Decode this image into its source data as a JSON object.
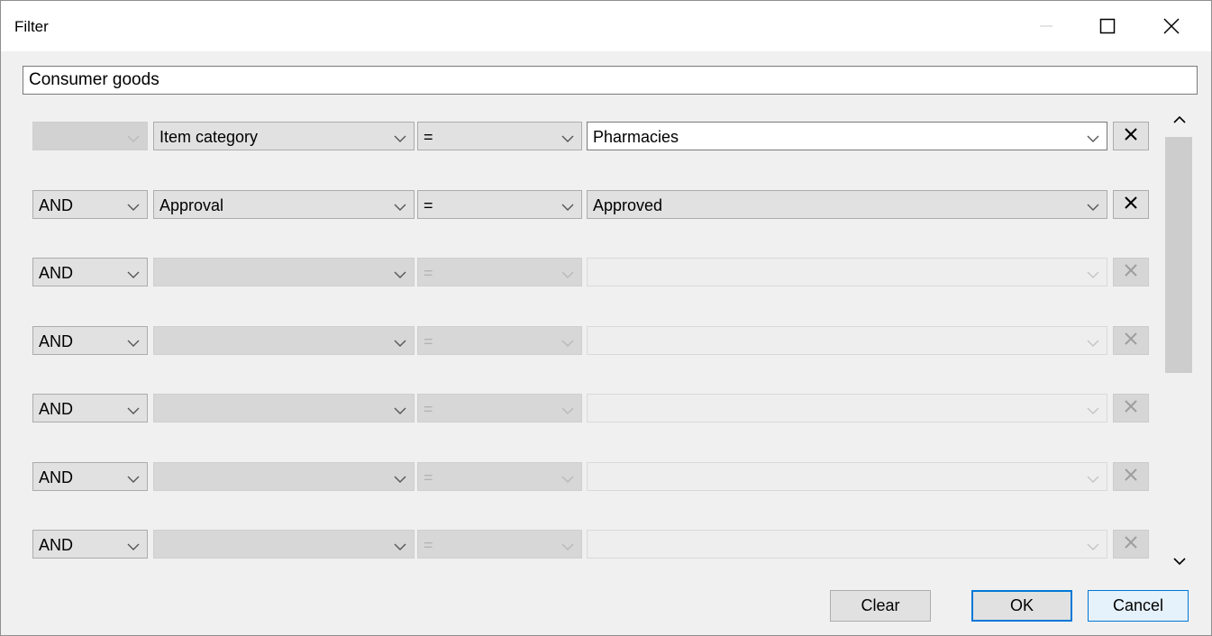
{
  "window": {
    "title": "Filter",
    "controls": [
      "minimize-icon",
      "maximize-icon",
      "close-icon"
    ]
  },
  "filter_name": {
    "value": "Consumer goods"
  },
  "rows": [
    {
      "logic": "",
      "field": "Item category",
      "operator": "=",
      "value": "Pharmacies",
      "enabled": true
    },
    {
      "logic": "AND",
      "field": "Approval",
      "operator": "=",
      "value": "Approved",
      "enabled": true
    },
    {
      "logic": "AND",
      "field": "",
      "operator": "=",
      "value": "",
      "enabled": false
    },
    {
      "logic": "AND",
      "field": "",
      "operator": "=",
      "value": "",
      "enabled": false
    },
    {
      "logic": "AND",
      "field": "",
      "operator": "=",
      "value": "",
      "enabled": false
    },
    {
      "logic": "AND",
      "field": "",
      "operator": "=",
      "value": "",
      "enabled": false
    },
    {
      "logic": "AND",
      "field": "",
      "operator": "=",
      "value": "",
      "enabled": false
    }
  ],
  "buttons": {
    "clear": "Clear",
    "ok": "OK",
    "cancel": "Cancel"
  },
  "colors": {
    "accent": "#0078d7",
    "window_bg": "#f0f0f0",
    "control_bg": "#e1e1e1"
  }
}
